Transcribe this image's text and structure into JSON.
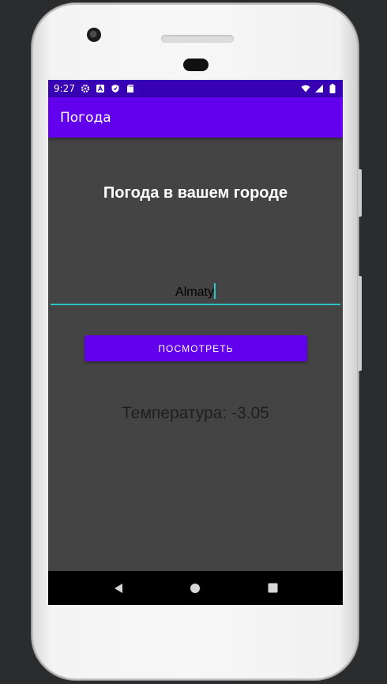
{
  "status_bar": {
    "time": "9:27",
    "icons": [
      "gear-icon",
      "font-icon",
      "shield-icon",
      "sd-card-icon",
      "wifi-icon",
      "signal-icon",
      "battery-icon"
    ]
  },
  "app_bar": {
    "title": "Погода"
  },
  "main": {
    "heading": "Погода в вашем городе",
    "city_input": {
      "value": "Almaty"
    },
    "button_label": "ПОСМОТРЕТЬ",
    "temperature_text": "Температура: -3.05"
  },
  "nav_bar": {
    "icons": [
      "back-icon",
      "home-icon",
      "recents-icon"
    ]
  },
  "colors": {
    "status_bar": "#3700b3",
    "app_bar": "#6200ee",
    "accent": "#2ec4c7",
    "background": "#444444"
  }
}
